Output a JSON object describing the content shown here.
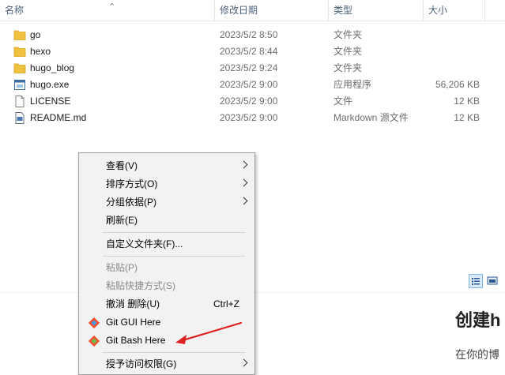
{
  "columns": {
    "name": "名称",
    "date": "修改日期",
    "type": "类型",
    "size": "大小"
  },
  "files": [
    {
      "name": "go",
      "date": "2023/5/2 8:50",
      "type": "文件夹",
      "size": "",
      "icon": "folder-icon"
    },
    {
      "name": "hexo",
      "date": "2023/5/2 8:44",
      "type": "文件夹",
      "size": "",
      "icon": "folder-icon"
    },
    {
      "name": "hugo_blog",
      "date": "2023/5/2 9:24",
      "type": "文件夹",
      "size": "",
      "icon": "folder-icon"
    },
    {
      "name": "hugo.exe",
      "date": "2023/5/2 9:00",
      "type": "应用程序",
      "size": "56,206 KB",
      "icon": "exe-icon"
    },
    {
      "name": "LICENSE",
      "date": "2023/5/2 9:00",
      "type": "文件",
      "size": "12 KB",
      "icon": "file-icon"
    },
    {
      "name": "README.md",
      "date": "2023/5/2 9:00",
      "type": "Markdown 源文件",
      "size": "12 KB",
      "icon": "markdown-icon"
    }
  ],
  "menu": {
    "view": "查看(V)",
    "sort": "排序方式(O)",
    "group": "分组依据(P)",
    "refresh": "刷新(E)",
    "customize": "自定义文件夹(F)...",
    "paste": "粘贴(P)",
    "paste_shortcut": "粘贴快捷方式(S)",
    "undo": "撤消 删除(U)",
    "undo_shortcut": "Ctrl+Z",
    "git_gui": "Git GUI Here",
    "git_bash": "Git Bash Here",
    "give_access": "授予访问权限(G)"
  },
  "webpage": {
    "heading": "创建h",
    "text": "在你的博"
  },
  "colors": {
    "folder": "#f0c040",
    "arrow": "#e02020",
    "menu_bg": "#f2f2f2",
    "header_text": "#4c607a"
  }
}
